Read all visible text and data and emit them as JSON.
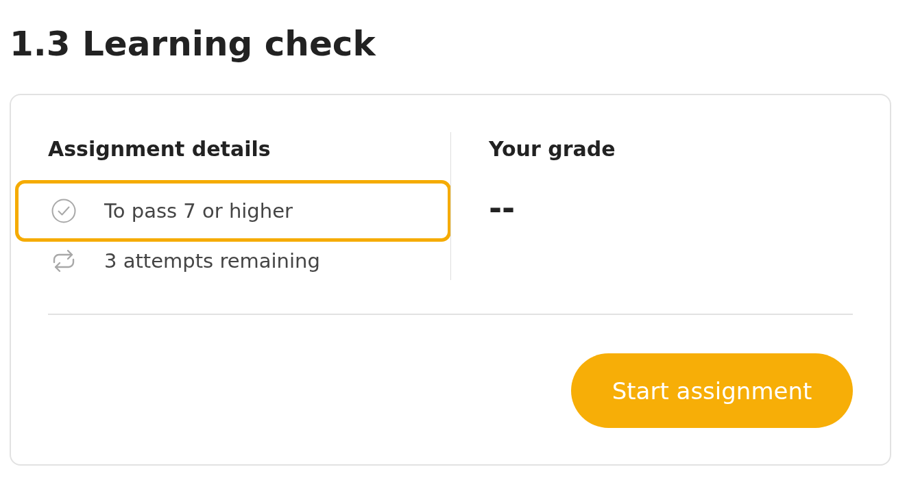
{
  "page": {
    "title": "1.3 Learning check"
  },
  "assignment_details": {
    "heading": "Assignment details",
    "items": [
      {
        "kind": "pass",
        "text": "To pass 7 or higher",
        "highlighted": true
      },
      {
        "kind": "attempts",
        "text": "3 attempts remaining",
        "highlighted": false
      }
    ]
  },
  "grade": {
    "heading": "Your grade",
    "value": "--"
  },
  "start_button": {
    "label": "Start assignment"
  }
}
